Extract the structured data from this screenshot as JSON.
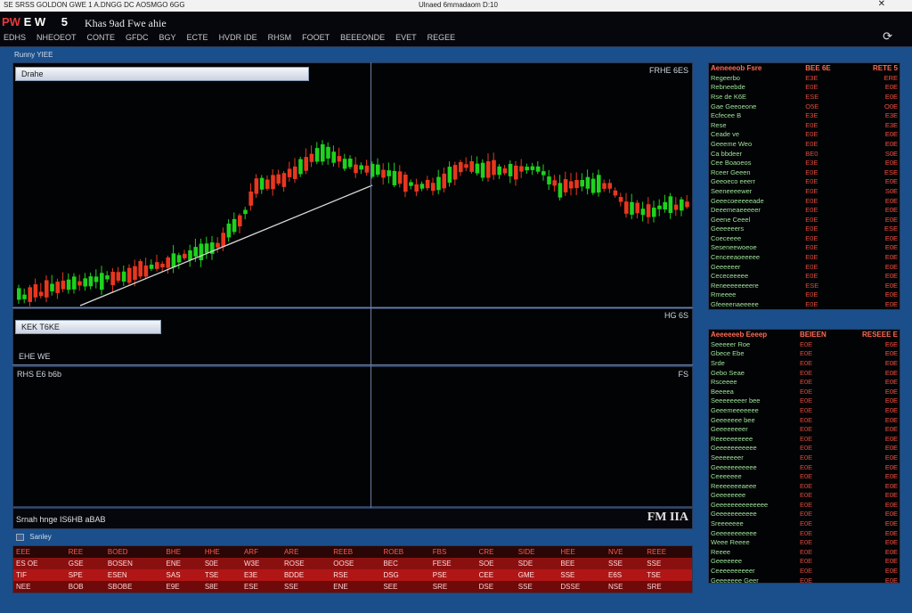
{
  "window": {
    "title_left": "SE SRSS GOLDON GWE 1 A.DNGG DC AOSMGO 6GG",
    "title_center": "Ulnaed 6mmadaom D:10",
    "title_right": "✕"
  },
  "app": {
    "logo": "PW",
    "logo_suffix": "E W",
    "logo_num": "5",
    "name": "Khas 9ad Fwe ahie"
  },
  "menu": [
    "EDHS",
    "NHEOEOT",
    "CONTE",
    "GFDC",
    "BGY",
    "ECTE",
    "HVDR IDE",
    "RHSM",
    "FOOET",
    "BEEEONDE",
    "EVET",
    "REGEE"
  ],
  "menu_icon": "⟳",
  "status_strip": "Runny YIEE",
  "chart": {
    "pane_label": "Drahe",
    "corner_label": "FRHE 6ES",
    "type": "candlestick",
    "series": {
      "up_color": "#1ed21e",
      "down_color": "#e8371e",
      "trend_color": "#d8d8d8"
    }
  },
  "indicator": {
    "pane_label": "KEK T6KE",
    "corner_label": "HG 6S",
    "sublabel": "EHE WE"
  },
  "volume": {
    "corner_left": "RHS E6 b6b",
    "corner_right": "FS"
  },
  "footer": {
    "left": "Srnah hnge IS6HB aBAB",
    "right": "FM IIA"
  },
  "ticker": {
    "header": "Sanley",
    "rows": [
      [
        "EEE",
        "REE",
        "BOED",
        "BHE",
        "HHE",
        "ARF",
        "ARE",
        "REEB",
        "ROEB",
        "FBS",
        "CRE",
        "SIDE",
        "HEE",
        "NVE",
        "REEE"
      ],
      [
        "ES OE",
        "GSE",
        "BOSEN",
        "ENE",
        "S0E",
        "W3E",
        "ROSE",
        "OOSE",
        "BEC",
        "FESE",
        "SOE",
        "SDE",
        "BEE",
        "SSE",
        "SSE"
      ],
      [
        "TIF",
        "SPE",
        "ESEN",
        "SAS",
        "TSE",
        "E3E",
        "BDDE",
        "RSE",
        "DSG",
        "PSE",
        "CEE",
        "GME",
        "SSE",
        "E6S",
        "TSE"
      ],
      [
        "NEE",
        "BOB",
        "SBOBE",
        "E9E",
        "S8E",
        "ESE",
        "SSE",
        "ENE",
        "SEE",
        "SRE",
        "DSE",
        "SSE",
        "DSSE",
        "NSE",
        "SRE"
      ]
    ]
  },
  "watchlist_top": {
    "headers": [
      "Aeneeeob Fsre",
      "BEE 6E",
      "RETE 5"
    ],
    "rows": [
      [
        "Regeerbo",
        "E3E",
        "ERE"
      ],
      [
        "Rebneebde",
        "E0E",
        "E0E"
      ],
      [
        "Rse de K6E",
        "ESE",
        "E0E"
      ],
      [
        "Gae Geeoeone",
        "O5E",
        "O0E"
      ],
      [
        "Ecfecee B",
        "E3E",
        "E3E"
      ],
      [
        "Rese",
        "E0E",
        "E3E"
      ],
      [
        "Ceade ve",
        "E0E",
        "E0E"
      ],
      [
        "Geeeme Weo",
        "E0E",
        "E0E"
      ],
      [
        "Ca bbdeer",
        "BE0",
        "S0E"
      ],
      [
        "Cee Boaoeos",
        "E3E",
        "E0E"
      ],
      [
        "Rceer Geeen",
        "E0E",
        "ESE"
      ],
      [
        "Geeoeco eeerr",
        "E0E",
        "E0E"
      ],
      [
        "Seeneeeewer",
        "E0E",
        "S0E"
      ],
      [
        "Geeecoeeeeeade",
        "E0E",
        "E0E"
      ],
      [
        "Deeemeaeeeeer",
        "E0E",
        "E0E"
      ],
      [
        "Geene Ceeel",
        "E0E",
        "E0E"
      ],
      [
        "Geeeeeers",
        "E0E",
        "ESE"
      ],
      [
        "Coeceeee",
        "E0E",
        "E0E"
      ],
      [
        "Seseneewoeoe",
        "E0E",
        "E0E"
      ],
      [
        "Cenceeaoeeeee",
        "E0E",
        "E0E"
      ],
      [
        "Geeeeeer",
        "E0E",
        "E0E"
      ],
      [
        "Cececeeeee",
        "E0E",
        "E0E"
      ],
      [
        "Reneeeeeeeere",
        "ESE",
        "E0E"
      ],
      [
        "Rmeeee",
        "E0E",
        "E0E"
      ],
      [
        "Gfeeeenaeeeee",
        "E0E",
        "E0E"
      ]
    ]
  },
  "watchlist_bottom": {
    "headers": [
      "Aeeeeeeb Eeeep",
      "BEIEEN",
      "RESEEE E"
    ],
    "rows": [
      [
        "Seeeeer Roe",
        "E0E",
        "E6E"
      ],
      [
        "Gbece Ebe",
        "E0E",
        "E0E"
      ],
      [
        "Srde",
        "E0E",
        "E0E"
      ],
      [
        "Gebo Seae",
        "E0E",
        "E0E"
      ],
      [
        "Rsceeee",
        "E0E",
        "E0E"
      ],
      [
        "Beeeea",
        "E0E",
        "E0E"
      ],
      [
        "Seeeeeeeer bee",
        "E0E",
        "E0E"
      ],
      [
        "Geeemeeeeeee",
        "E0E",
        "E0E"
      ],
      [
        "Geeeeeee bee",
        "E0E",
        "E0E"
      ],
      [
        "Geeeeeeeer",
        "E0E",
        "E0E"
      ],
      [
        "Reeeeeeeeee",
        "E0E",
        "E0E"
      ],
      [
        "Geeeeeeeeeee",
        "E0E",
        "E0E"
      ],
      [
        "Seeeeeeer",
        "E0E",
        "E0E"
      ],
      [
        "Geeeeeeeeeee",
        "E0E",
        "E0E"
      ],
      [
        "Ceeeeeee",
        "E0E",
        "E0E"
      ],
      [
        "Reeeeeeeaeee",
        "E0E",
        "E0E"
      ],
      [
        "Geeeeeeee",
        "E0E",
        "E0E"
      ],
      [
        "Geeeeeeeeeeeeee",
        "E0E",
        "E0E"
      ],
      [
        "Geeeeeeeeeee",
        "E0E",
        "E0E"
      ],
      [
        "Sreeeeeee",
        "E0E",
        "E0E"
      ],
      [
        "Geeeeeeeeeee",
        "E0E",
        "E0E"
      ],
      [
        "Weee Reeee",
        "E0E",
        "E0E"
      ],
      [
        "Reeee",
        "E0E",
        "E0E"
      ],
      [
        "Geeeeeee",
        "E0E",
        "E0E"
      ],
      [
        "Ceeeeeeeeeer",
        "E0E",
        "E0E"
      ],
      [
        "Geeeeeee Geer",
        "E0E",
        "E0E"
      ]
    ]
  }
}
